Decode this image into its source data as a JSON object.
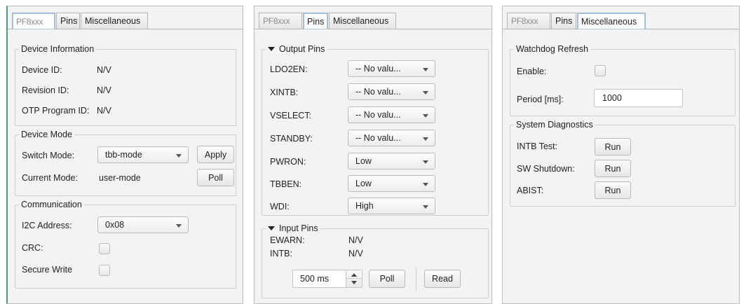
{
  "tabs": {
    "logo_text": "PF8xxx",
    "pins": "Pins",
    "misc": "Miscellaneous"
  },
  "panel1": {
    "device_info": {
      "title": "Device Information",
      "rows": [
        {
          "label": "Device ID:",
          "value": "N/V"
        },
        {
          "label": "Revision ID:",
          "value": "N/V"
        },
        {
          "label": "OTP Program ID:",
          "value": "N/V"
        }
      ]
    },
    "device_mode": {
      "title": "Device Mode",
      "switch_label": "Switch Mode:",
      "switch_value": "tbb-mode",
      "apply": "Apply",
      "current_label": "Current Mode:",
      "current_value": "user-mode",
      "poll": "Poll"
    },
    "communication": {
      "title": "Communication",
      "i2c_label": "I2C Address:",
      "i2c_value": "0x08",
      "crc_label": "CRC:",
      "crc_checked": false,
      "secure_label": "Secure Write",
      "secure_checked": false
    }
  },
  "panel2": {
    "output": {
      "title": "Output Pins",
      "pins": [
        {
          "label": "LDO2EN:",
          "value": "-- No valu..."
        },
        {
          "label": "XINTB:",
          "value": "-- No valu..."
        },
        {
          "label": "VSELECT:",
          "value": "-- No valu..."
        },
        {
          "label": "STANDBY:",
          "value": "-- No valu..."
        },
        {
          "label": "PWRON:",
          "value": "Low"
        },
        {
          "label": "TBBEN:",
          "value": "Low"
        },
        {
          "label": "WDI:",
          "value": "High"
        }
      ]
    },
    "input": {
      "title": "Input Pins",
      "pins": [
        {
          "label": "EWARN:",
          "value": "N/V"
        },
        {
          "label": "INTB:",
          "value": "N/V"
        }
      ],
      "interval": "500 ms",
      "poll": "Poll",
      "read": "Read"
    }
  },
  "panel3": {
    "watchdog": {
      "title": "Watchdog Refresh",
      "enable_label": "Enable:",
      "enable_checked": false,
      "period_label": "Period [ms]:",
      "period_value": "1000"
    },
    "diagnostics": {
      "title": "System Diagnostics",
      "items": [
        {
          "label": "INTB Test:",
          "button": "Run"
        },
        {
          "label": "SW Shutdown:",
          "button": "Run"
        },
        {
          "label": "ABIST:",
          "button": "Run"
        }
      ]
    }
  }
}
